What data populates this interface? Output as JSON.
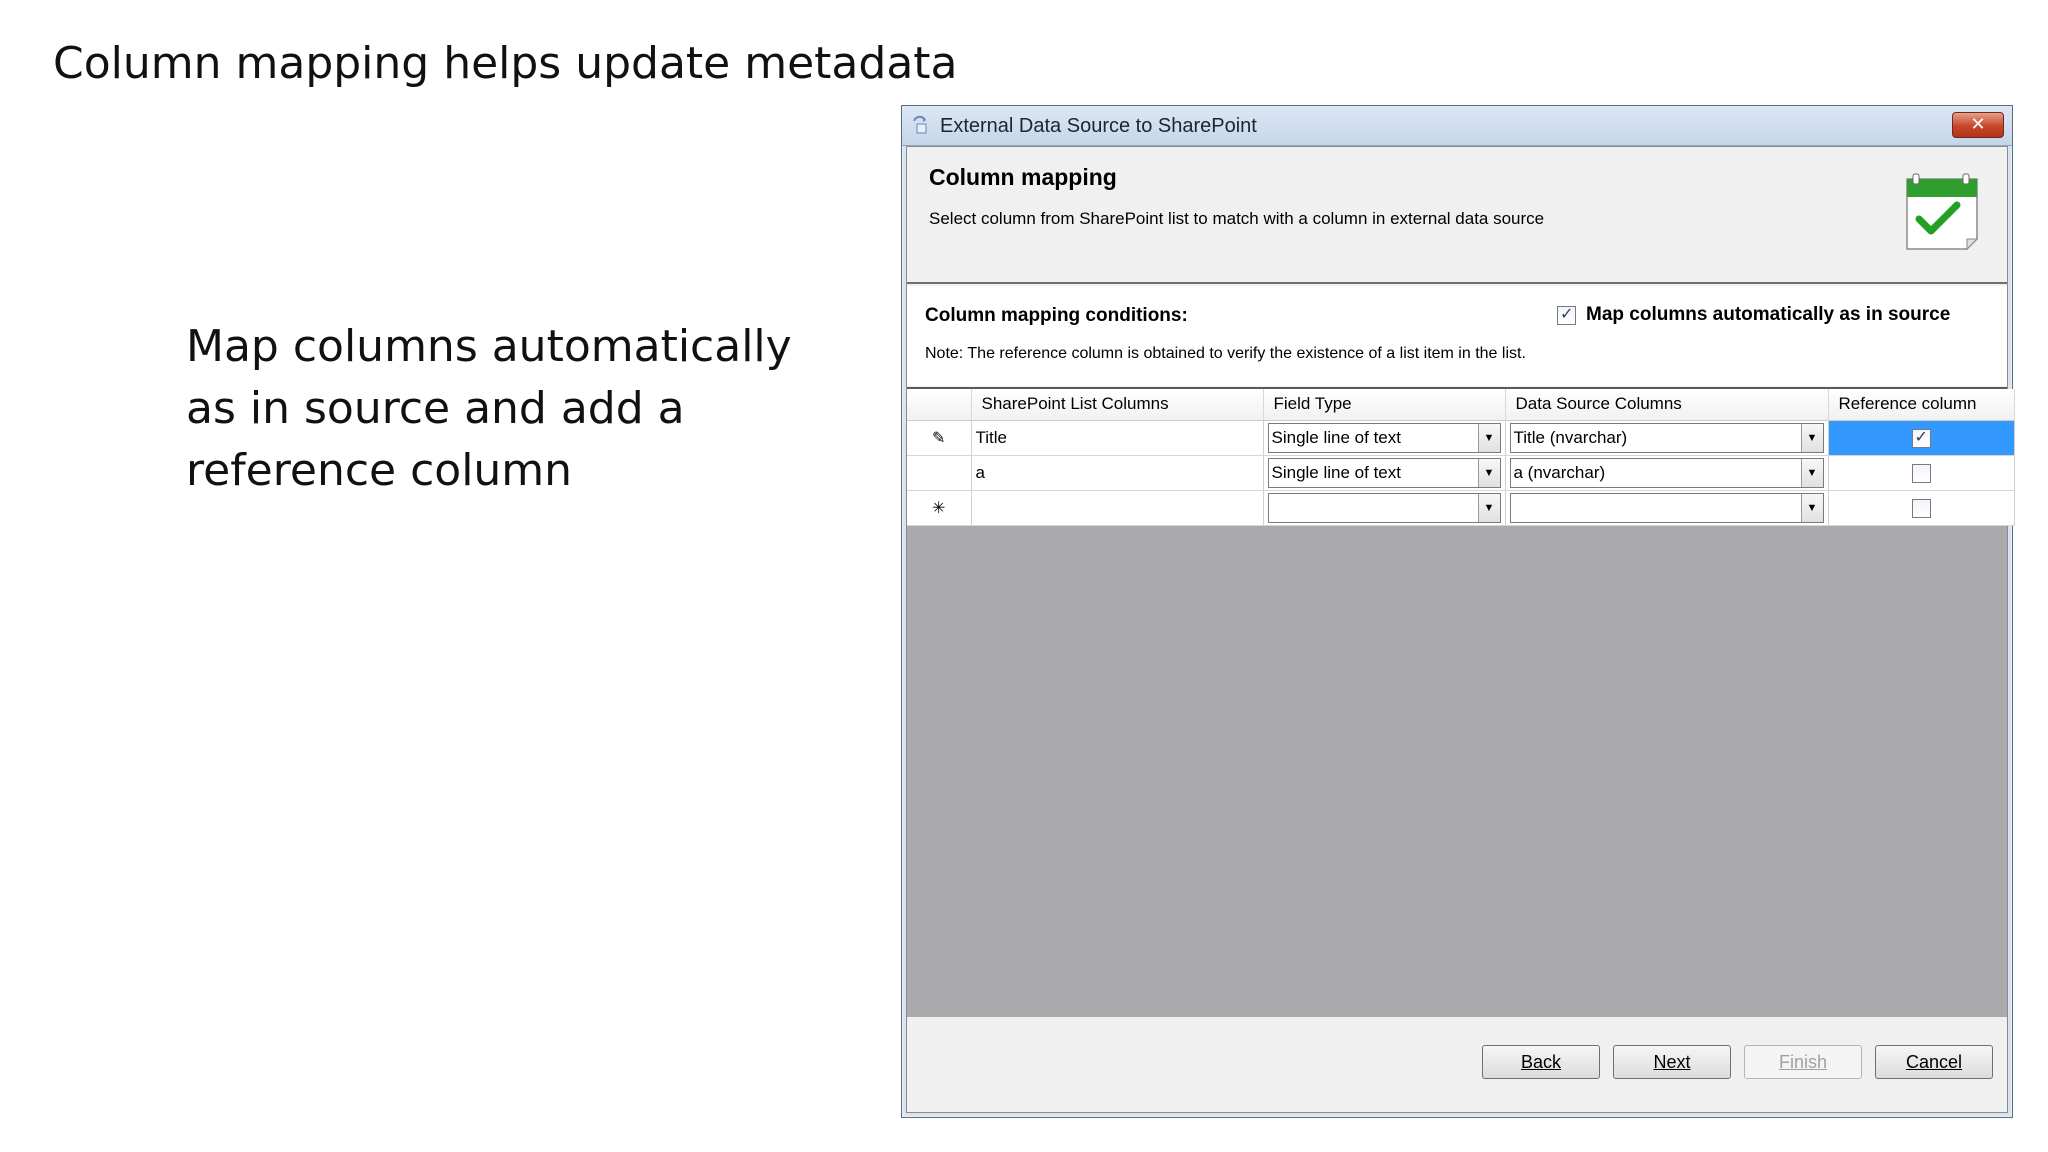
{
  "slide": {
    "title": "Column mapping helps update metadata",
    "body_lines": [
      "Map columns automatically",
      "as in source and add a",
      "reference column"
    ]
  },
  "window": {
    "title": "External Data Source to SharePoint",
    "close_label": "✕"
  },
  "page": {
    "heading": "Column mapping",
    "description": "Select column from SharePoint list to match with a column in external data source"
  },
  "conditions": {
    "label": "Column mapping conditions:",
    "auto_map_label": "Map columns automatically as in source",
    "auto_map_checked": true,
    "note": "Note: The reference column is obtained to verify the existence of a list item in the list."
  },
  "grid": {
    "columns": [
      "SharePoint List Columns",
      "Field Type",
      "Data Source Columns",
      "Reference column"
    ],
    "rows": [
      {
        "indicator": "✎",
        "sp_column": "Title",
        "field_type": "Single line of text",
        "source": "Title (nvarchar)",
        "reference": true
      },
      {
        "indicator": "",
        "sp_column": "a",
        "field_type": "Single line of text",
        "source": "a (nvarchar)",
        "reference": false
      },
      {
        "indicator": "✳",
        "sp_column": "",
        "field_type": "",
        "source": "",
        "reference": false
      }
    ]
  },
  "buttons": {
    "back": "Back",
    "next": "Next",
    "finish": "Finish",
    "cancel": "Cancel"
  },
  "colors": {
    "selection": "#3399ff",
    "grid_background": "#aaaaac",
    "close_button": "#c8452a"
  }
}
